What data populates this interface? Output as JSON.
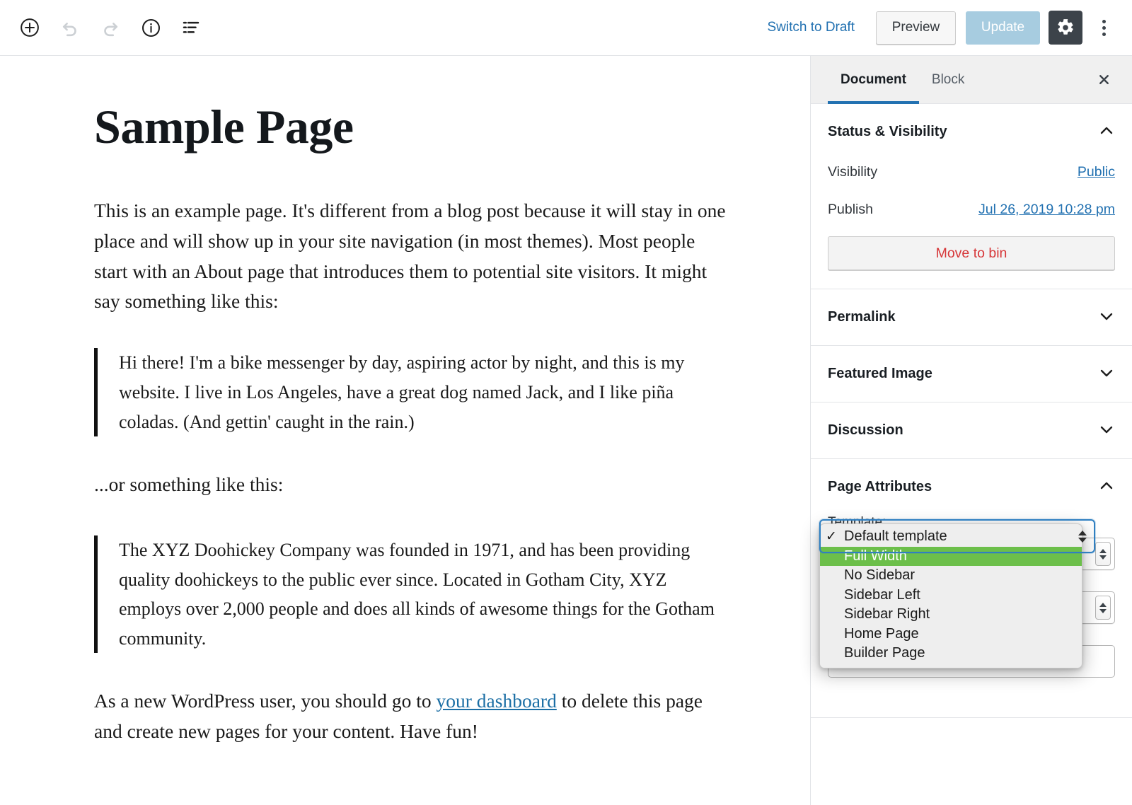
{
  "toolbar": {
    "icons": [
      {
        "name": "add-block-icon",
        "label": "Add block"
      },
      {
        "name": "undo-icon",
        "label": "Undo"
      },
      {
        "name": "redo-icon",
        "label": "Redo"
      },
      {
        "name": "info-icon",
        "label": "Content structure"
      },
      {
        "name": "list-view-icon",
        "label": "Block navigation"
      }
    ],
    "switch_to_draft": "Switch to Draft",
    "preview_label": "Preview",
    "update_label": "Update",
    "update_disabled": true,
    "settings_icon": "gear-icon",
    "more_icon": "more-vertical-icon"
  },
  "document": {
    "title": "Sample Page",
    "blocks": [
      {
        "type": "paragraph",
        "text": "This is an example page. It's different from a blog post because it will stay in one place and will show up in your site navigation (in most themes). Most people start with an About page that introduces them to potential site visitors. It might say something like this:"
      },
      {
        "type": "quote",
        "text": "Hi there! I'm a bike messenger by day, aspiring actor by night, and this is my website. I live in Los Angeles, have a great dog named Jack, and I like piña coladas. (And gettin' caught in the rain.)"
      },
      {
        "type": "paragraph",
        "text": "...or something like this:"
      },
      {
        "type": "quote",
        "text": "The XYZ Doohickey Company was founded in 1971, and has been providing quality doohickeys to the public ever since. Located in Gotham City, XYZ employs over 2,000 people and does all kinds of awesome things for the Gotham community."
      },
      {
        "type": "paragraph-with-link",
        "text_before": "As a new WordPress user, you should go to ",
        "link_text": "your dashboard",
        "text_after": " to delete this page and create new pages for your content. Have fun!"
      }
    ]
  },
  "sidebar": {
    "tabs": [
      {
        "label": "Document",
        "active": true
      },
      {
        "label": "Block",
        "active": false
      }
    ],
    "close_icon": "close-icon",
    "status_visibility": {
      "title": "Status & Visibility",
      "expanded": true,
      "visibility_label": "Visibility",
      "visibility_value": "Public",
      "publish_label": "Publish",
      "publish_value": "Jul 26, 2019 10:28 pm",
      "trash_label": "Move to bin"
    },
    "permalink": {
      "title": "Permalink",
      "expanded": false
    },
    "featured_image": {
      "title": "Featured Image",
      "expanded": false
    },
    "discussion": {
      "title": "Discussion",
      "expanded": false
    },
    "page_attributes": {
      "title": "Page Attributes",
      "expanded": true,
      "template_label": "Template:",
      "template_value": "Default template",
      "dropdown_open": true,
      "options": [
        {
          "label": "Default template",
          "checked": true,
          "highlighted": false
        },
        {
          "label": "Full Width",
          "checked": false,
          "highlighted": true
        },
        {
          "label": "No Sidebar",
          "checked": false,
          "highlighted": false
        },
        {
          "label": "Sidebar Left",
          "checked": false,
          "highlighted": false
        },
        {
          "label": "Sidebar Right",
          "checked": false,
          "highlighted": false
        },
        {
          "label": "Home Page",
          "checked": false,
          "highlighted": false
        },
        {
          "label": "Builder Page",
          "checked": false,
          "highlighted": false
        }
      ],
      "checkmark_glyph": "✓"
    }
  },
  "colors": {
    "accent_blue": "#2271b1",
    "link_blue": "#1c6fa5",
    "highlight_green": "#6cbf4a",
    "danger_red": "#d63638",
    "gear_bg": "#3c434a",
    "update_disabled_bg": "#a7cce0",
    "tabbar_bg": "#f0f0f0",
    "border_gray": "#e2e4e7"
  }
}
